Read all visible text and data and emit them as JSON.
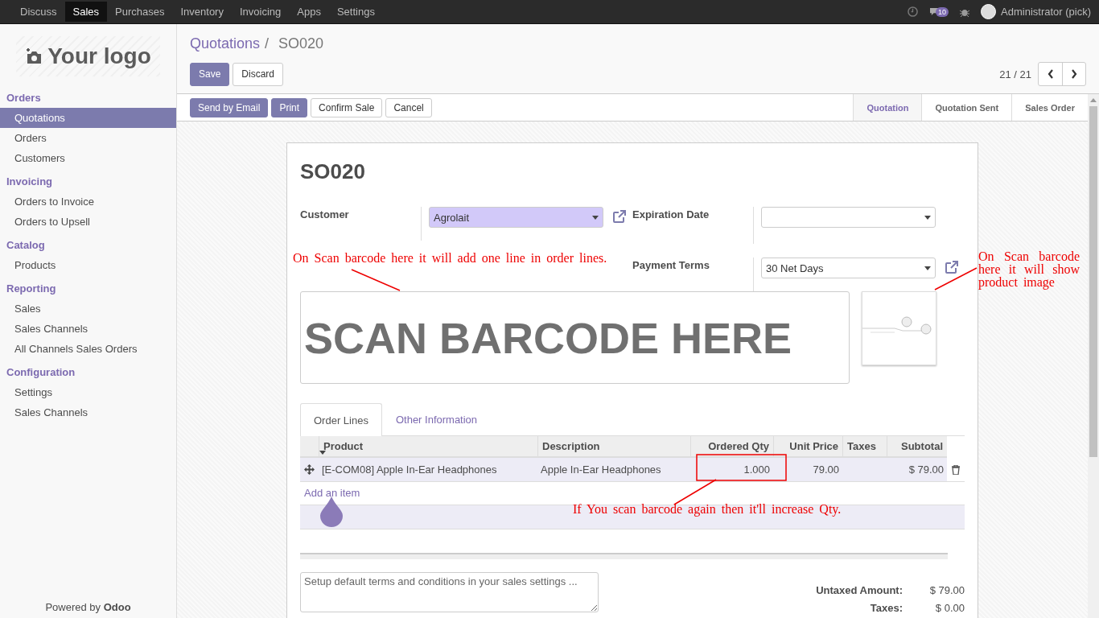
{
  "top_menu": [
    {
      "label": "Discuss",
      "selected": false
    },
    {
      "label": "Sales",
      "selected": true
    },
    {
      "label": "Purchases",
      "selected": false
    },
    {
      "label": "Inventory",
      "selected": false
    },
    {
      "label": "Invoicing",
      "selected": false
    },
    {
      "label": "Apps",
      "selected": false
    },
    {
      "label": "Settings",
      "selected": false
    }
  ],
  "systray": {
    "message_count": "10",
    "user": "Administrator (pick)"
  },
  "sidebar": {
    "logo_text": "Your logo",
    "sections": [
      {
        "title": "Orders",
        "items": [
          {
            "label": "Quotations",
            "selected": true
          },
          {
            "label": "Orders",
            "selected": false
          },
          {
            "label": "Customers",
            "selected": false
          }
        ]
      },
      {
        "title": "Invoicing",
        "items": [
          {
            "label": "Orders to Invoice",
            "selected": false
          },
          {
            "label": "Orders to Upsell",
            "selected": false
          }
        ]
      },
      {
        "title": "Catalog",
        "items": [
          {
            "label": "Products",
            "selected": false
          }
        ]
      },
      {
        "title": "Reporting",
        "items": [
          {
            "label": "Sales",
            "selected": false
          },
          {
            "label": "Sales Channels",
            "selected": false
          },
          {
            "label": "All Channels Sales Orders",
            "selected": false
          }
        ]
      },
      {
        "title": "Configuration",
        "items": [
          {
            "label": "Settings",
            "selected": false
          },
          {
            "label": "Sales Channels",
            "selected": false
          }
        ]
      }
    ],
    "footer": "Powered by **Odoo**"
  },
  "breadcrumb": {
    "parent": "Quotations",
    "separator": "/",
    "current": "SO020"
  },
  "form_buttons": [
    {
      "label": "Save",
      "kind": "primary"
    },
    {
      "label": "Discard",
      "kind": "secondary"
    }
  ],
  "pager": "21 / 21",
  "action_buttons": [
    {
      "label": "Send by Email",
      "kind": "primary"
    },
    {
      "label": "Print",
      "kind": "primary"
    },
    {
      "label": "Confirm Sale",
      "kind": "secondary"
    },
    {
      "label": "Cancel",
      "kind": "secondary"
    }
  ],
  "stages": [
    {
      "label": "Quotation",
      "selected": true
    },
    {
      "label": "Quotation Sent",
      "selected": false
    },
    {
      "label": "Sales Order",
      "selected": false
    }
  ],
  "sheet": {
    "title": "SO020",
    "left_fields": [
      {
        "label": "Customer",
        "value": "Agrolait",
        "required": true,
        "external_link": true
      }
    ],
    "right_fields": [
      {
        "label": "Expiration Date",
        "required": false,
        "external_link": false
      },
      {
        "label": "Payment Terms",
        "value": "30 Net Days",
        "required": false,
        "external_link": true
      }
    ],
    "barcode_placeholder": "SCAN BARCODE HERE",
    "tabs": [
      {
        "label": "Order Lines",
        "selected": true
      },
      {
        "label": "Other Information",
        "selected": false
      }
    ],
    "columns": [
      {
        "label": "Product",
        "sorted": true
      },
      {
        "label": "Description",
        "sorted": false
      },
      {
        "label": "Ordered Qty",
        "sorted": false
      },
      {
        "label": "Unit Price",
        "sorted": false
      },
      {
        "label": "Taxes",
        "sorted": false
      },
      {
        "label": "Subtotal",
        "sorted": false
      }
    ],
    "rows": [
      {
        "product": "[E-COM08] Apple In-Ear Headphones",
        "description": "Apple In-Ear Headphones",
        "ordered_qty": "1.000",
        "unit_price": "79.00",
        "subtotal": "$ 79.00"
      }
    ],
    "add_item": "Add an item",
    "terms_placeholder": "Setup default terms and conditions in your sales settings ...",
    "totals": [
      {
        "label": "Untaxed Amount:",
        "value": "$ 79.00"
      },
      {
        "label": "Taxes:",
        "value": "$ 0.00"
      }
    ]
  },
  "annotations": [
    {
      "text": "On Scan barcode here it will add one line in order lines."
    },
    {
      "text": "On Scan barcode here it will show product image"
    },
    {
      "text": "If You scan barcode again then it'll increase Qty."
    }
  ]
}
